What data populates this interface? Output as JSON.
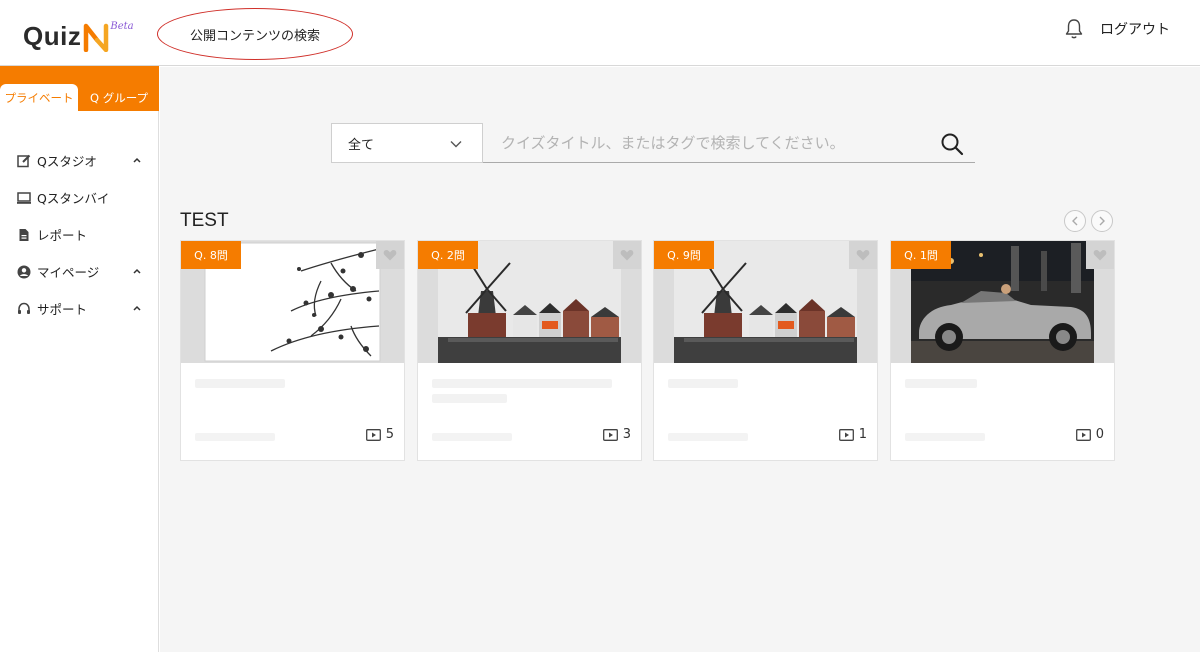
{
  "header": {
    "logo_text": "Quiz",
    "logo_beta": "Beta",
    "public_search_label": "公開コンテンツの検索",
    "logout_label": "ログアウト"
  },
  "sidebar": {
    "tabs": [
      {
        "label": "プライベート",
        "active": true
      },
      {
        "label": "Q グループ",
        "active": false
      }
    ],
    "items": [
      {
        "label": "Qスタジオ",
        "icon": "edit-icon",
        "expandable": true
      },
      {
        "label": "Qスタンバイ",
        "icon": "monitor-icon",
        "expandable": false
      },
      {
        "label": "レポート",
        "icon": "document-icon",
        "expandable": false
      },
      {
        "label": "マイページ",
        "icon": "user-icon",
        "expandable": true
      },
      {
        "label": "サポート",
        "icon": "headset-icon",
        "expandable": true
      }
    ]
  },
  "search": {
    "category_value": "全て",
    "placeholder": "クイズタイトル、またはタグで検索してください。"
  },
  "section": {
    "title": "TEST"
  },
  "cards": [
    {
      "badge": "Q. 8問",
      "count": "5",
      "thumb": "branches"
    },
    {
      "badge": "Q. 2問",
      "count": "3",
      "thumb": "windmill"
    },
    {
      "badge": "Q. 9問",
      "count": "1",
      "thumb": "windmill"
    },
    {
      "badge": "Q. 1問",
      "count": "0",
      "thumb": "car"
    }
  ],
  "colors": {
    "accent": "#f57c00",
    "annotation_circle": "#d0302a",
    "main_bg": "#f5f5f5"
  }
}
